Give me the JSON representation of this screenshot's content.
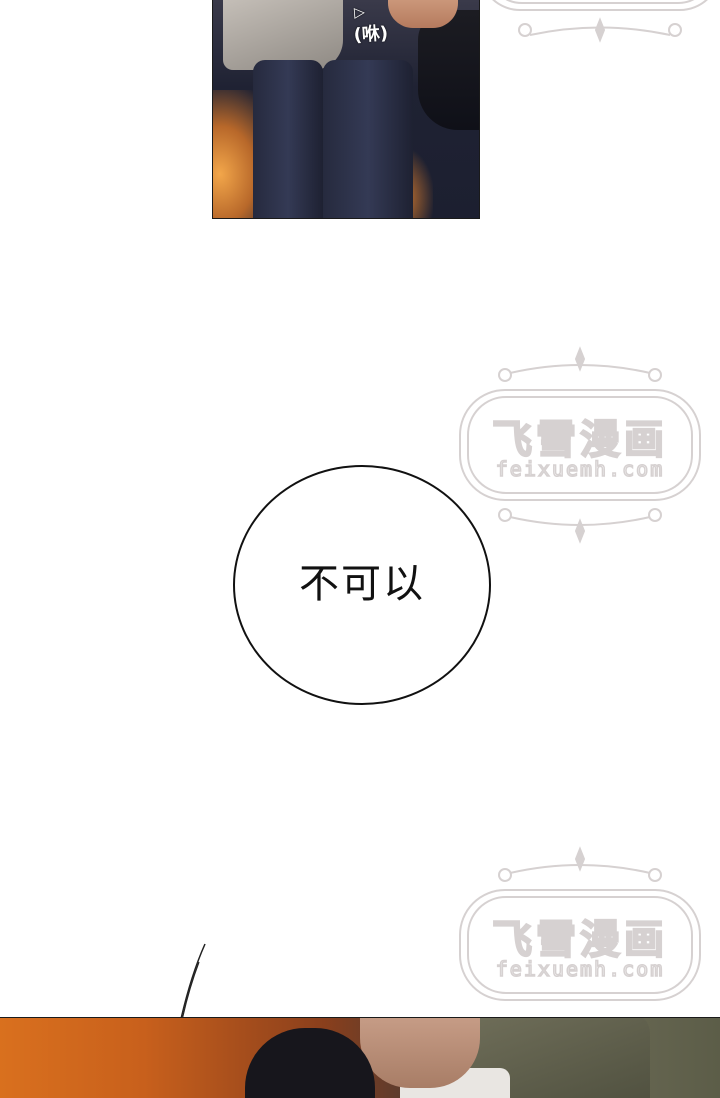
{
  "panel_top": {
    "sfx_text": "(咻)",
    "sfx_arrow": "▷"
  },
  "watermark": {
    "title": "飞雪漫画",
    "url": "feixuemh.com"
  },
  "speech_bubble": {
    "text": "不可以"
  },
  "colors": {
    "background": "#ffffff",
    "ink": "#111111",
    "watermark_stroke": "#d6d1d1"
  }
}
